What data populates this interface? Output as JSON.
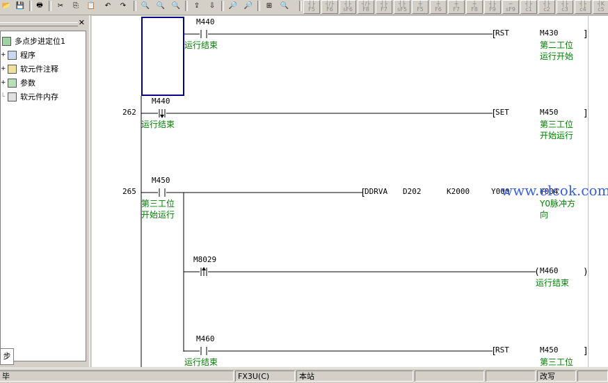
{
  "toolbar": {
    "fkeys": [
      {
        "glyph": "┤├",
        "label": "F5"
      },
      {
        "glyph": "┤/├",
        "label": "F6"
      },
      {
        "glyph": "┤├",
        "label": "sF6"
      },
      {
        "glyph": "┤/├",
        "label": "F8"
      },
      {
        "glyph": "┤├",
        "label": "F7"
      },
      {
        "glyph": "┤├",
        "label": "sF5"
      },
      {
        "glyph": "┼",
        "label": "F5"
      },
      {
        "glyph": "┼",
        "label": "F6"
      },
      {
        "glyph": "┼",
        "label": "F7"
      },
      {
        "glyph": "┼",
        "label": "F8"
      },
      {
        "glyph": "┤├",
        "label": "F9"
      },
      {
        "glyph": "─",
        "label": "sF9"
      },
      {
        "glyph": "┤├",
        "label": "c1"
      },
      {
        "glyph": "┤├",
        "label": "c2"
      },
      {
        "glyph": "┤├",
        "label": "c3"
      },
      {
        "glyph": "┤├",
        "label": "c4"
      },
      {
        "glyph": "┤K",
        "label": "c5"
      }
    ]
  },
  "tree": {
    "root": "多点步进定位1",
    "items": [
      "程序",
      "软元件注释",
      "参数",
      "软元件内存"
    ]
  },
  "left_tab": "步",
  "ladder": {
    "rungs": [
      {
        "step": "",
        "contact": "M440",
        "contact_comment": "运行结束",
        "instr": "RST",
        "operand": "M430",
        "comment": [
          "第二工位",
          "运行开始"
        ]
      },
      {
        "step": "262",
        "contact": "M440",
        "contact_comment": "运行结束",
        "instr": "SET",
        "operand": "M450",
        "comment": [
          "第三工位",
          "开始运行"
        ]
      },
      {
        "step": "265",
        "contact": "M450",
        "contact_comment": [
          "第三工位",
          "开始运行"
        ],
        "instr": "DDRVA",
        "args": [
          "D202",
          "K2000",
          "Y000",
          "Y004"
        ],
        "comment": [
          "Y0脉冲方",
          "向"
        ]
      },
      {
        "step": "",
        "contact": "M8029",
        "contact_comment": "",
        "instr": "",
        "operand": "M460",
        "comment": [
          "运行结束"
        ]
      },
      {
        "step": "",
        "contact": "M460",
        "contact_comment": "运行结束",
        "instr": "RST",
        "operand": "M450",
        "comment": [
          "第三工位"
        ]
      }
    ]
  },
  "watermark": "www.elcok.com",
  "status": {
    "left": "毕",
    "plc": "FX3U(C)",
    "station": "本站",
    "mode": "改写"
  }
}
